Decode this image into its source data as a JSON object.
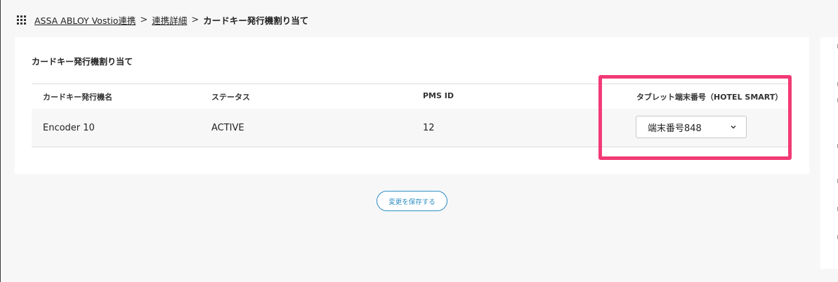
{
  "breadcrumb": {
    "items": [
      {
        "label": "ASSA ABLOY Vostio連携",
        "link": true
      },
      {
        "label": "連携詳細",
        "link": true
      },
      {
        "label": "カードキー発行機割り当て",
        "link": false
      }
    ],
    "separator": ">",
    "icon": "grid-menu-icon"
  },
  "card": {
    "title": "カードキー発行機割り当て",
    "table": {
      "headers": [
        "カードキー発行機名",
        "ステータス",
        "PMS ID",
        "タブレット端末番号（HOTEL SMART）"
      ],
      "rows": [
        {
          "name": "Encoder 10",
          "status": "ACTIVE",
          "pms_id": "12",
          "tablet": "端末番号848"
        }
      ]
    }
  },
  "save_button": {
    "label": "変更を保存する"
  },
  "colors": {
    "highlight": "#f23a76",
    "accent": "#2f8fc5",
    "background": "#f7f7f7"
  }
}
